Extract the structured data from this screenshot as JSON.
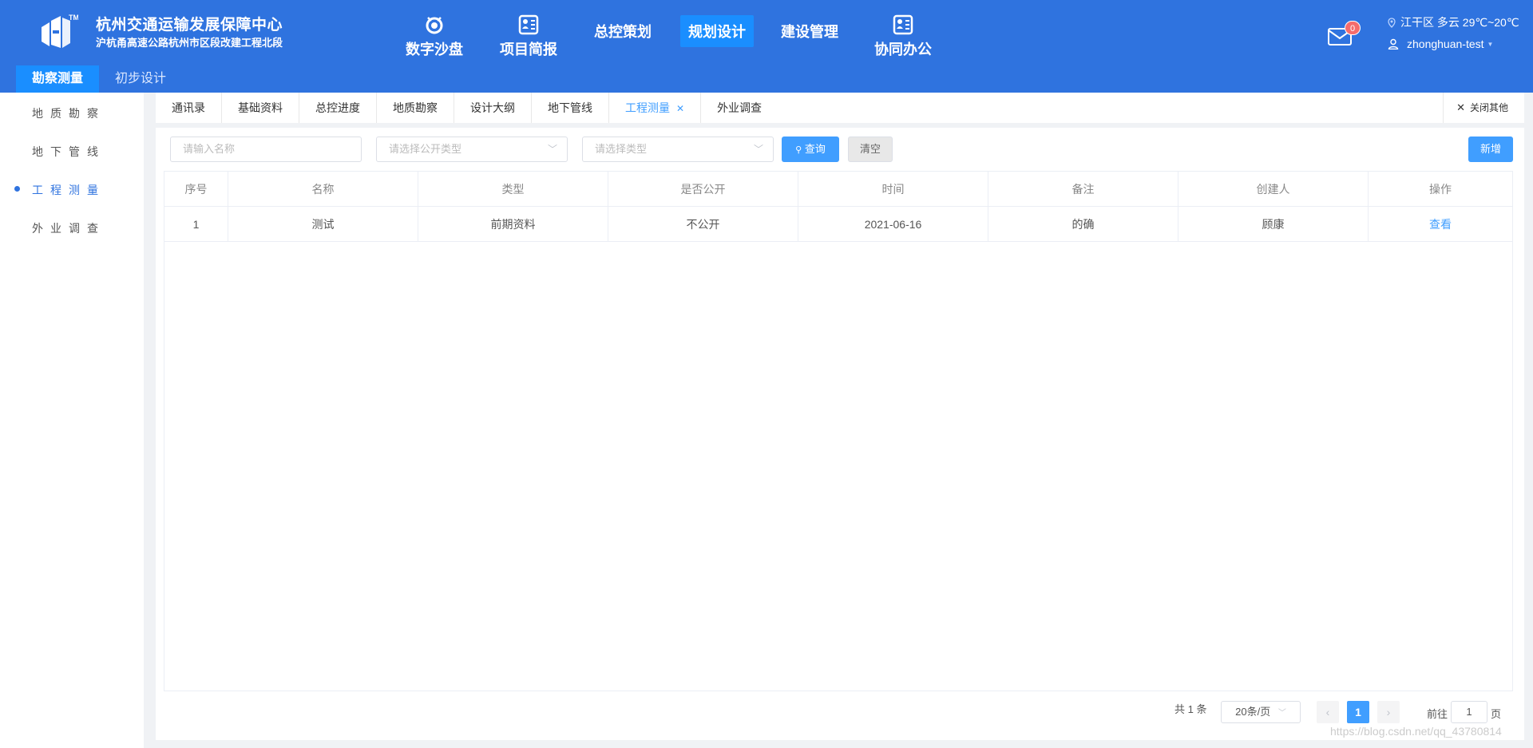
{
  "brand": {
    "title": "杭州交通运输发展保障中心",
    "subtitle": "沪杭甬高速公路杭州市区段改建工程北段"
  },
  "nav": [
    {
      "label": "数字沙盘",
      "icon": "sandbox-icon"
    },
    {
      "label": "项目简报",
      "icon": "report-icon"
    },
    {
      "label": "总控策划"
    },
    {
      "label": "规划设计",
      "active": true
    },
    {
      "label": "建设管理"
    },
    {
      "label": "协同办公",
      "icon": "office-icon"
    }
  ],
  "header_right": {
    "mail_count": "0",
    "weather": "江干区 多云 29℃~20℃",
    "username": "zhonghuan-test"
  },
  "subnav": [
    {
      "label": "勘察测量",
      "active": true
    },
    {
      "label": "初步设计"
    }
  ],
  "sidebar": [
    {
      "label": "地质勘察"
    },
    {
      "label": "地下管线"
    },
    {
      "label": "工程测量",
      "active": true
    },
    {
      "label": "外业调查"
    }
  ],
  "tabs": [
    {
      "label": "通讯录"
    },
    {
      "label": "基础资料"
    },
    {
      "label": "总控进度"
    },
    {
      "label": "地质勘察"
    },
    {
      "label": "设计大纲"
    },
    {
      "label": "地下管线"
    },
    {
      "label": "工程测量",
      "active": true
    },
    {
      "label": "外业调查"
    }
  ],
  "close_others": "关闭其他",
  "filters": {
    "name_placeholder": "请输入名称",
    "public_placeholder": "请选择公开类型",
    "type_placeholder": "请选择类型",
    "query_label": "查询",
    "clear_label": "清空",
    "add_label": "新增"
  },
  "table": {
    "headers": [
      "序号",
      "名称",
      "类型",
      "是否公开",
      "时间",
      "备注",
      "创建人",
      "操作"
    ],
    "rows": [
      [
        "1",
        "测试",
        "前期资料",
        "不公开",
        "2021-06-16",
        "的确",
        "顾康",
        "查看"
      ]
    ]
  },
  "pagination": {
    "total": "共 1 条",
    "page_size": "20条/页",
    "current_page": "1",
    "goto_prefix": "前往",
    "goto_value": "1",
    "goto_suffix": "页"
  },
  "watermark": "https://blog.csdn.net/qq_43780814",
  "colors": {
    "header_bg": "#2f73df",
    "active_bg": "#1a8eff",
    "primary": "#409eff"
  }
}
